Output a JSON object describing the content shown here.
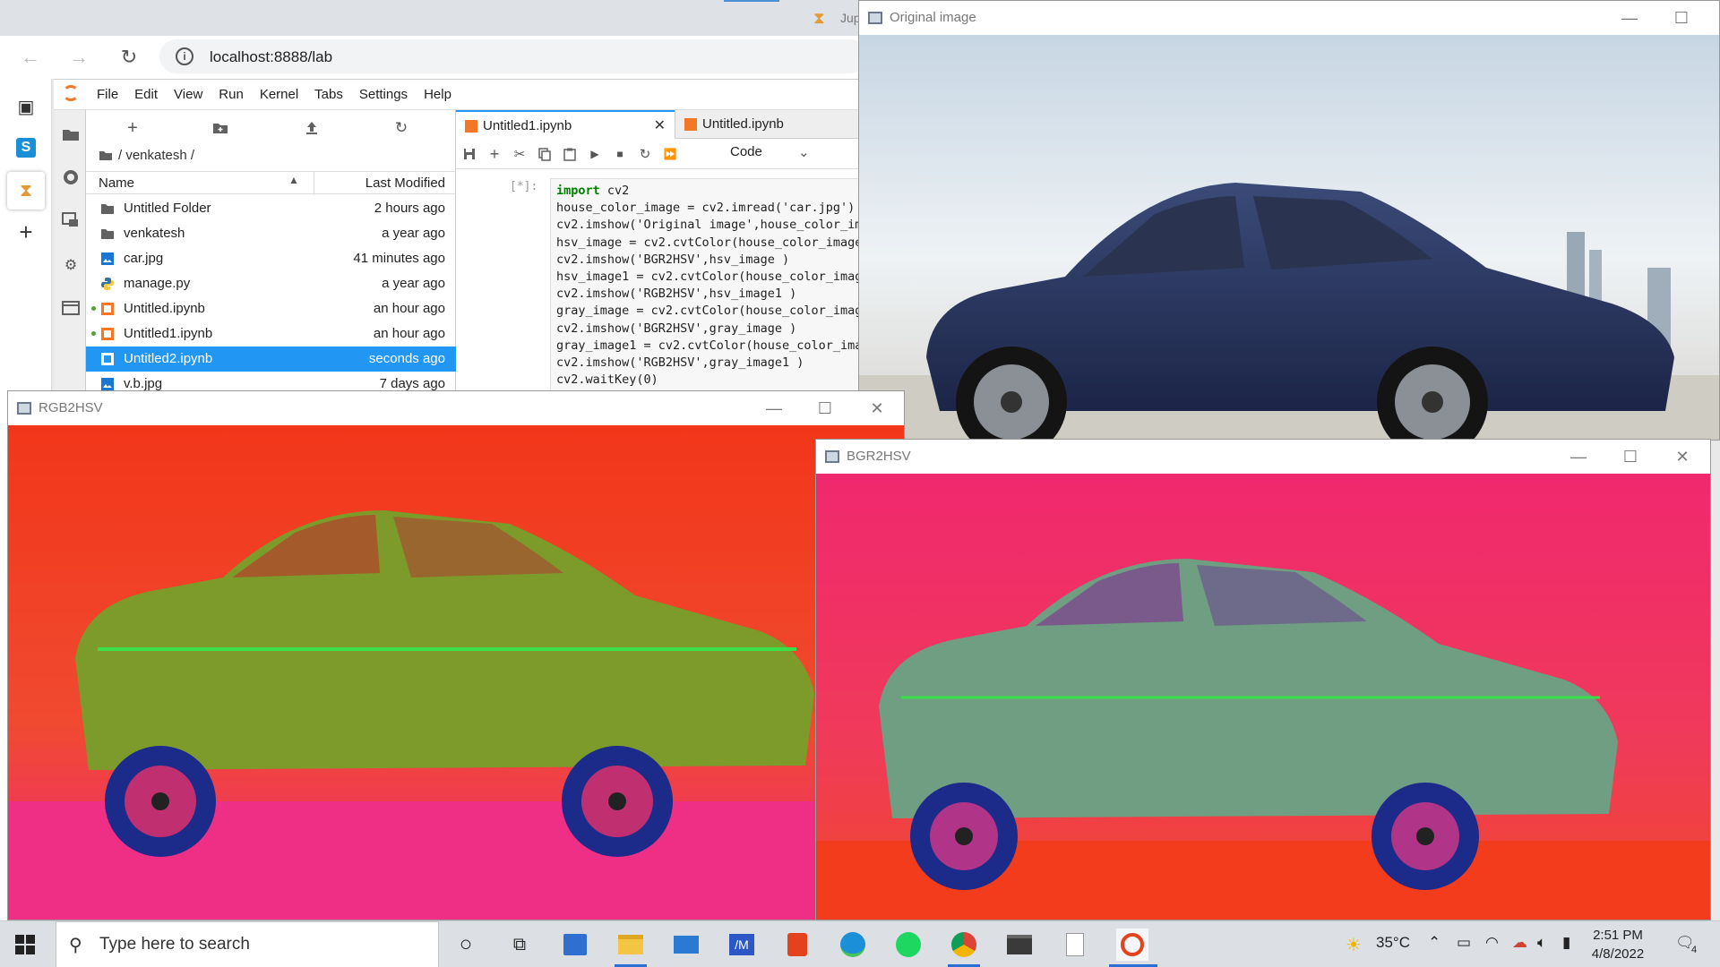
{
  "browser": {
    "url": "localhost:8888/lab",
    "partial_tab_text": "Jup"
  },
  "jupyter": {
    "menu": [
      "File",
      "Edit",
      "View",
      "Run",
      "Kernel",
      "Tabs",
      "Settings",
      "Help"
    ],
    "breadcrumb": "/ venkatesh /",
    "filebrowser": {
      "col_name": "Name",
      "col_modified": "Last Modified",
      "files": [
        {
          "name": "Untitled Folder",
          "modified": "2 hours ago",
          "type": "folder",
          "running": false,
          "selected": false
        },
        {
          "name": "venkatesh",
          "modified": "a year ago",
          "type": "folder",
          "running": false,
          "selected": false
        },
        {
          "name": "car.jpg",
          "modified": "41 minutes ago",
          "type": "image",
          "running": false,
          "selected": false
        },
        {
          "name": "manage.py",
          "modified": "a year ago",
          "type": "python",
          "running": false,
          "selected": false
        },
        {
          "name": "Untitled.ipynb",
          "modified": "an hour ago",
          "type": "notebook",
          "running": true,
          "selected": false
        },
        {
          "name": "Untitled1.ipynb",
          "modified": "an hour ago",
          "type": "notebook",
          "running": true,
          "selected": false
        },
        {
          "name": "Untitled2.ipynb",
          "modified": "seconds ago",
          "type": "notebook",
          "running": false,
          "selected": true
        },
        {
          "name": "v.b.jpg",
          "modified": "7 days ago",
          "type": "image",
          "running": false,
          "selected": false
        }
      ]
    },
    "notebook": {
      "tabs": [
        {
          "label": "Untitled1.ipynb",
          "active": true
        },
        {
          "label": "Untitled.ipynb",
          "active": false
        }
      ],
      "cell_type": "Code",
      "prompt": "[*]:",
      "code_lines": [
        "import cv2",
        "house_color_image = cv2.imread('car.jpg')",
        "cv2.imshow('Original image',house_color_image)",
        "hsv_image = cv2.cvtColor(house_color_image",
        "cv2.imshow('BGR2HSV',hsv_image )",
        "hsv_image1 = cv2.cvtColor(house_color_image",
        "cv2.imshow('RGB2HSV',hsv_image1 )",
        "gray_image = cv2.cvtColor(house_color_image",
        "cv2.imshow('BGR2HSV',gray_image )",
        "gray_image1 = cv2.cvtColor(house_color_image",
        "cv2.imshow('RGB2HSV',gray_image1 )",
        "cv2.waitKey(0)"
      ]
    }
  },
  "windows": {
    "original": {
      "title": "Original image"
    },
    "rgb2hsv": {
      "title": "RGB2HSV"
    },
    "bgr2hsv": {
      "title": "BGR2HSV"
    }
  },
  "taskbar": {
    "search_placeholder": "Type here to search",
    "weather": "35°C",
    "time": "2:51 PM",
    "date": "4/8/2022",
    "notification_count": "4",
    "apps": [
      "cortana",
      "task-view",
      "store",
      "file-explorer",
      "mail",
      "visual-studio",
      "office",
      "edge",
      "spotify",
      "chrome",
      "terminal",
      "blank-document",
      "python"
    ]
  },
  "colors": {
    "selection": "#2196f3",
    "jupyter_orange": "#f37726",
    "taskbar_bg": "#dcdfe4"
  }
}
